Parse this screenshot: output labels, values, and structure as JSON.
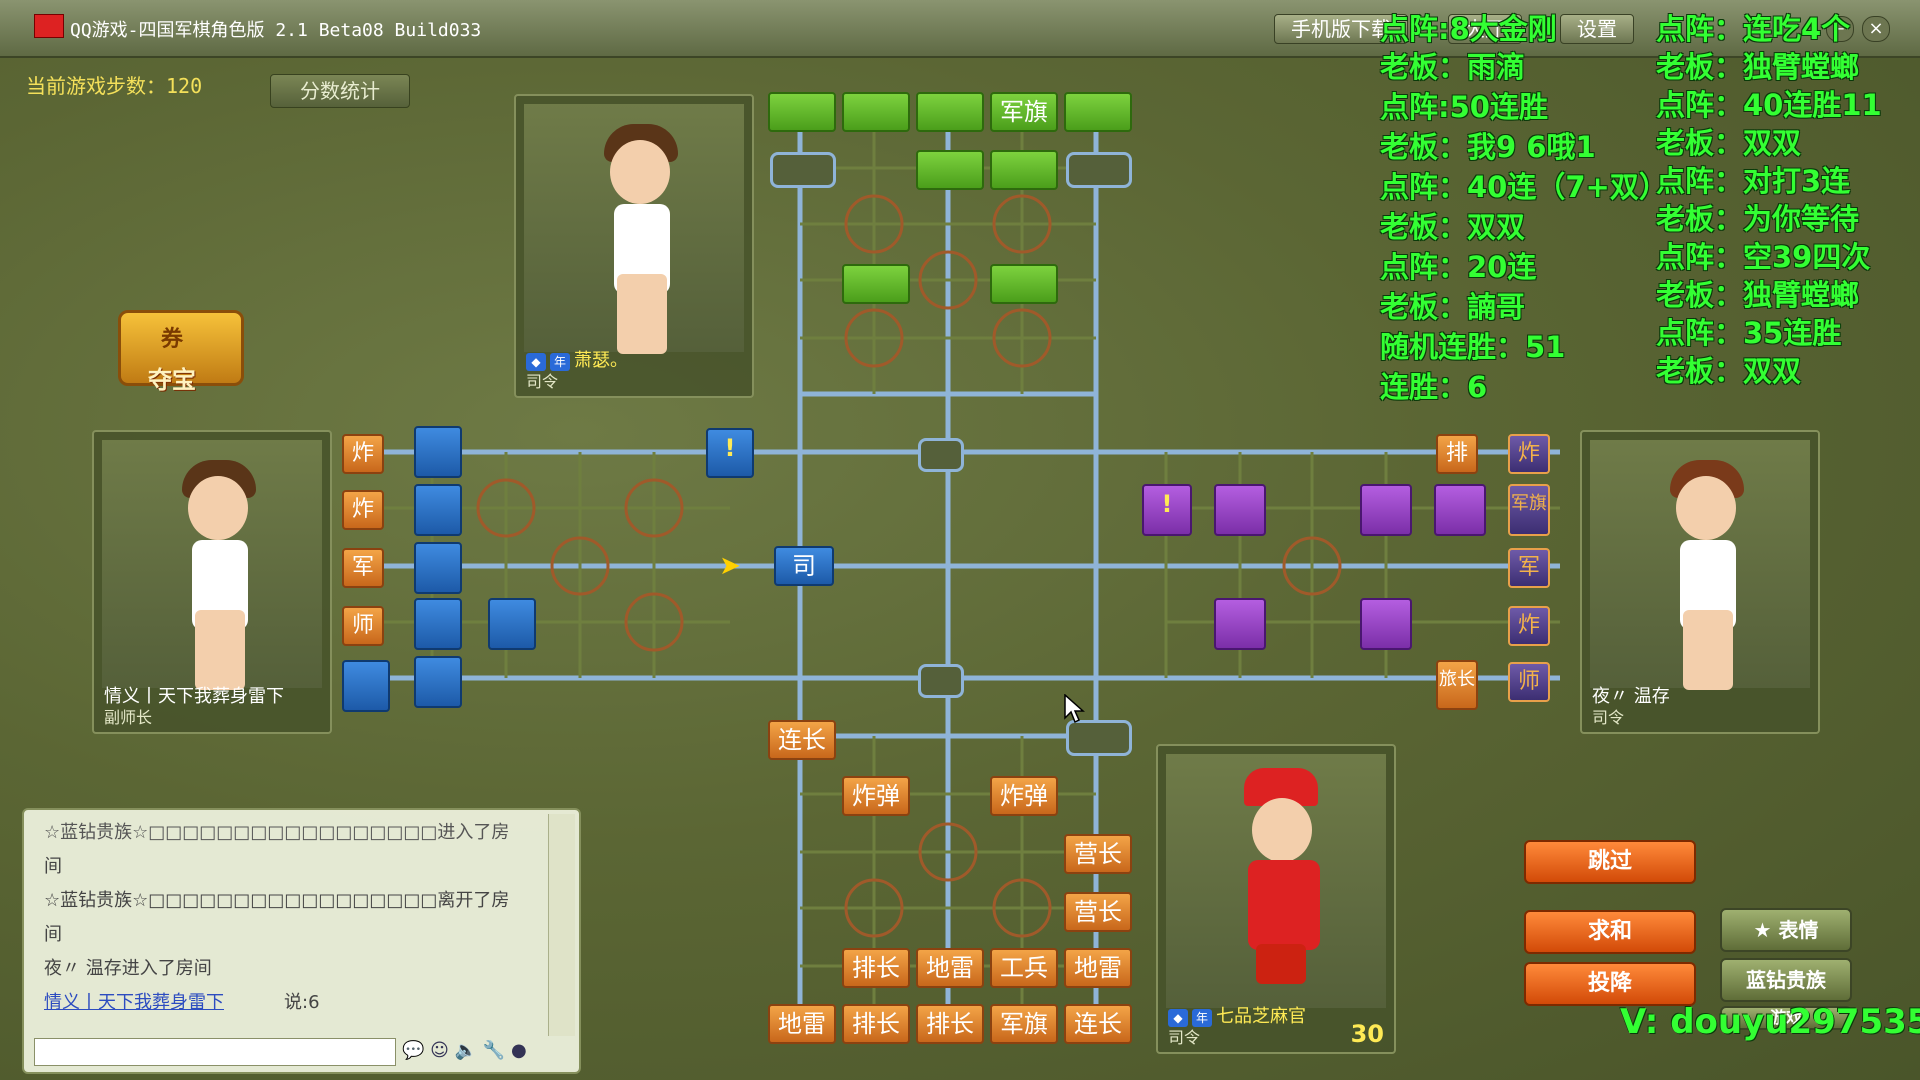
{
  "window": {
    "title": "QQ游戏-四国军棋角色版 2.1 Beta08 Build033",
    "buttons": [
      "手机版下载",
      "大厅",
      "设置"
    ]
  },
  "steps_label": "当前游戏步数：120",
  "stats_button": "分数统计",
  "treasure_label": "夺宝",
  "treasure_coupon": "券",
  "players": {
    "top": {
      "name": "萧瑟。",
      "rank": "司令"
    },
    "left": {
      "name": "情义丨天下我葬身雷下",
      "rank": "副师长"
    },
    "right": {
      "name": "夜〃 温存",
      "rank": "司令"
    },
    "bottom": {
      "name": "七品芝麻官",
      "rank": "司令",
      "timer": "30"
    }
  },
  "pieces": {
    "top": [
      "军旗"
    ],
    "left_side": [
      "炸",
      "炸",
      "军",
      "师"
    ],
    "right_side": [
      "排",
      "炸",
      "军旗",
      "军",
      "炸",
      "师",
      "旅长"
    ],
    "left_marker": "!",
    "right_marker": "!",
    "center": "司",
    "bottom": [
      "连长",
      "炸弹",
      "炸弹",
      "营长",
      "营长",
      "排长",
      "地雷",
      "工兵",
      "地雷",
      "地雷",
      "排长",
      "排长",
      "军旗",
      "连长"
    ]
  },
  "chat": {
    "lines": [
      "☆蓝钻贵族☆□□□□□□□□□□□□□□□□□进入了房",
      "间",
      "☆蓝钻贵族☆□□□□□□□□□□□□□□□□□离开了房",
      "间",
      "夜〃 温存进入了房间",
      "情义丨天下我葬身雷下",
      "说:6"
    ]
  },
  "actions": {
    "skip": "跳过",
    "draw": "求和",
    "surrender": "投降"
  },
  "side_buttons": {
    "emotes": "表情",
    "blue_diamond": "蓝钻贵族",
    "game": "游戏"
  },
  "overlay_left": [
    "点阵:8大金刚",
    "老板：雨滴",
    "点阵:50连胜",
    "老板：我9 6哦1",
    "点阵：40连（7+双）",
    "老板：双双",
    "点阵：20连",
    "老板：諵哥",
    "随机连胜：51",
    "连胜：6"
  ],
  "overlay_right": [
    "点阵：连吃4个",
    "老板：独臂螳螂",
    "点阵：40连胜11",
    "老板：双双",
    "点阵：对打3连",
    "老板：为你等待",
    "点阵：空39四次",
    "老板：独臂螳螂",
    "点阵：35连胜",
    "老板：双双"
  ],
  "watermark": "V: douyu297535"
}
